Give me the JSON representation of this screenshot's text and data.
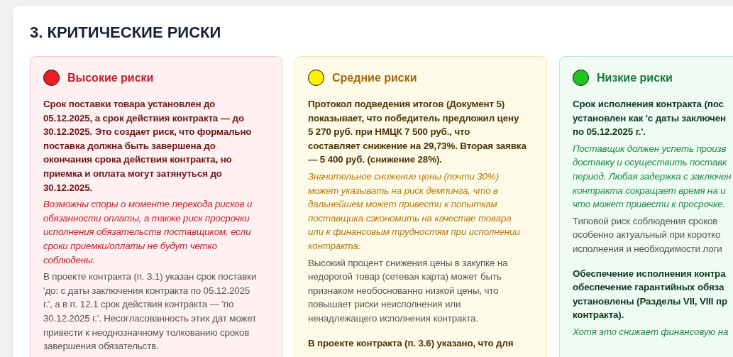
{
  "section": {
    "title": "3. КРИТИЧЕСКИЕ РИСКИ",
    "cards": [
      {
        "kind": "high",
        "color": "#ee1c25",
        "title": "Высокие риски",
        "paragraphs": [
          {
            "kind": "claim",
            "lines": [
              "Срок поставки товара установлен до",
              "05.12.2025, а срок действия контракта — до",
              "30.12.2025. Это создает риск, что формально",
              "поставка должна быть завершена до",
              "окончания срока действия контракта, но",
              "приемка и оплата могут затянуться до",
              "30.12.2025."
            ]
          },
          {
            "kind": "consequence",
            "lines": [
              "Возможны споры о моменте перехода рисков и",
              "обязанности оплаты, а также риск просрочки",
              "исполнения обязательств поставщиком, если",
              "сроки приемки/оплаты не будут четко",
              "соблюдены."
            ]
          },
          {
            "kind": "basis",
            "lines": [
              "В проекте контракта (п. 3.1) указан срок поставки",
              "'до: с даты заключения контракта по 05.12.2025",
              "г.', а в п. 12.1 срок действия контракта — 'по",
              "30.12.2025 г.'. Несогласованность этих дат может",
              "привести к неоднозначному толкованию сроков",
              "завершения обязательств."
            ]
          }
        ]
      },
      {
        "kind": "medium",
        "color": "#ffee00",
        "title": "Средние риски",
        "paragraphs": [
          {
            "kind": "claim",
            "lines": [
              "Протокол подведения итогов (Документ 5)",
              "показывает, что победитель предложил цену",
              "5 270 руб. при НМЦК 7 500 руб., что",
              "составляет снижение на 29,73%. Вторая заявка",
              "— 5 400 руб. (снижение 28%)."
            ]
          },
          {
            "kind": "consequence",
            "lines": [
              "Значительное снижение цены (почти 30%)",
              "может указывать на риск демпинга, что в",
              "дальнейшем может привести к попыткам",
              "поставщика сэкономить на качестве товара",
              "или к финансовым трудностям при исполнении",
              "контракта."
            ]
          },
          {
            "kind": "basis",
            "lines": [
              "Высокий процент снижения цены в закупке на",
              "недорогой товар (сетевая карта) может быть",
              "признаком необоснованно низкой цены, что",
              "повышает риски неисполнения или",
              "ненадлежащего исполнения контракта."
            ]
          },
          {
            "kind": "claim",
            "lines": [
              "В проекте контракта (п. 3.6) указано, что для"
            ]
          }
        ]
      },
      {
        "kind": "low",
        "color": "#22c41e",
        "title": "Низкие риски",
        "paragraphs": [
          {
            "kind": "claim",
            "lines": [
              "Срок исполнения контракта (пос",
              "установлен как 'с даты заключен",
              "по 05.12.2025 г.'."
            ]
          },
          {
            "kind": "consequence",
            "lines": [
              "Поставщик должен успеть произв",
              "доставку и осуществить поставк",
              "период. Любая задержка с заключен",
              "контракта сокращает время на и",
              "что может привести к просрочке."
            ]
          },
          {
            "kind": "basis",
            "lines": [
              "Типовой риск соблюдения сроков",
              "особенно актуальный при коротко",
              "исполнения и необходимости логи"
            ]
          },
          {
            "kind": "claim",
            "lines": [
              "Обеспечение исполнения контра",
              "обеспечение гарантийных обяза",
              "установлены (Разделы VII, VIII пр",
              "контракта)."
            ]
          },
          {
            "kind": "consequence",
            "lines": [
              "Хотя это снижает финансовую на"
            ]
          }
        ]
      }
    ]
  }
}
